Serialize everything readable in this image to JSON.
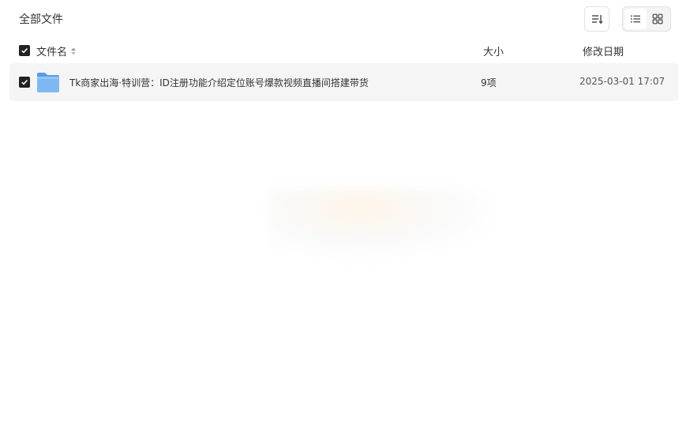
{
  "header": {
    "breadcrumb": "全部文件",
    "sort_icon": "sort-lines-icon",
    "view_list_icon": "list-view-icon",
    "view_grid_icon": "grid-view-icon"
  },
  "columns": {
    "name": "文件名",
    "size": "大小",
    "date": "修改日期"
  },
  "rows": [
    {
      "name": "Tk商家出海·特训营：ID注册功能介绍定位账号爆款视频直播间搭建带货",
      "size": "9项",
      "date": "2025-03-01 17:07",
      "icon": "folder-icon"
    }
  ],
  "colors": {
    "checkbox": "#222222",
    "row_bg": "#f5f5f5",
    "folder": "#6aaaf0"
  }
}
